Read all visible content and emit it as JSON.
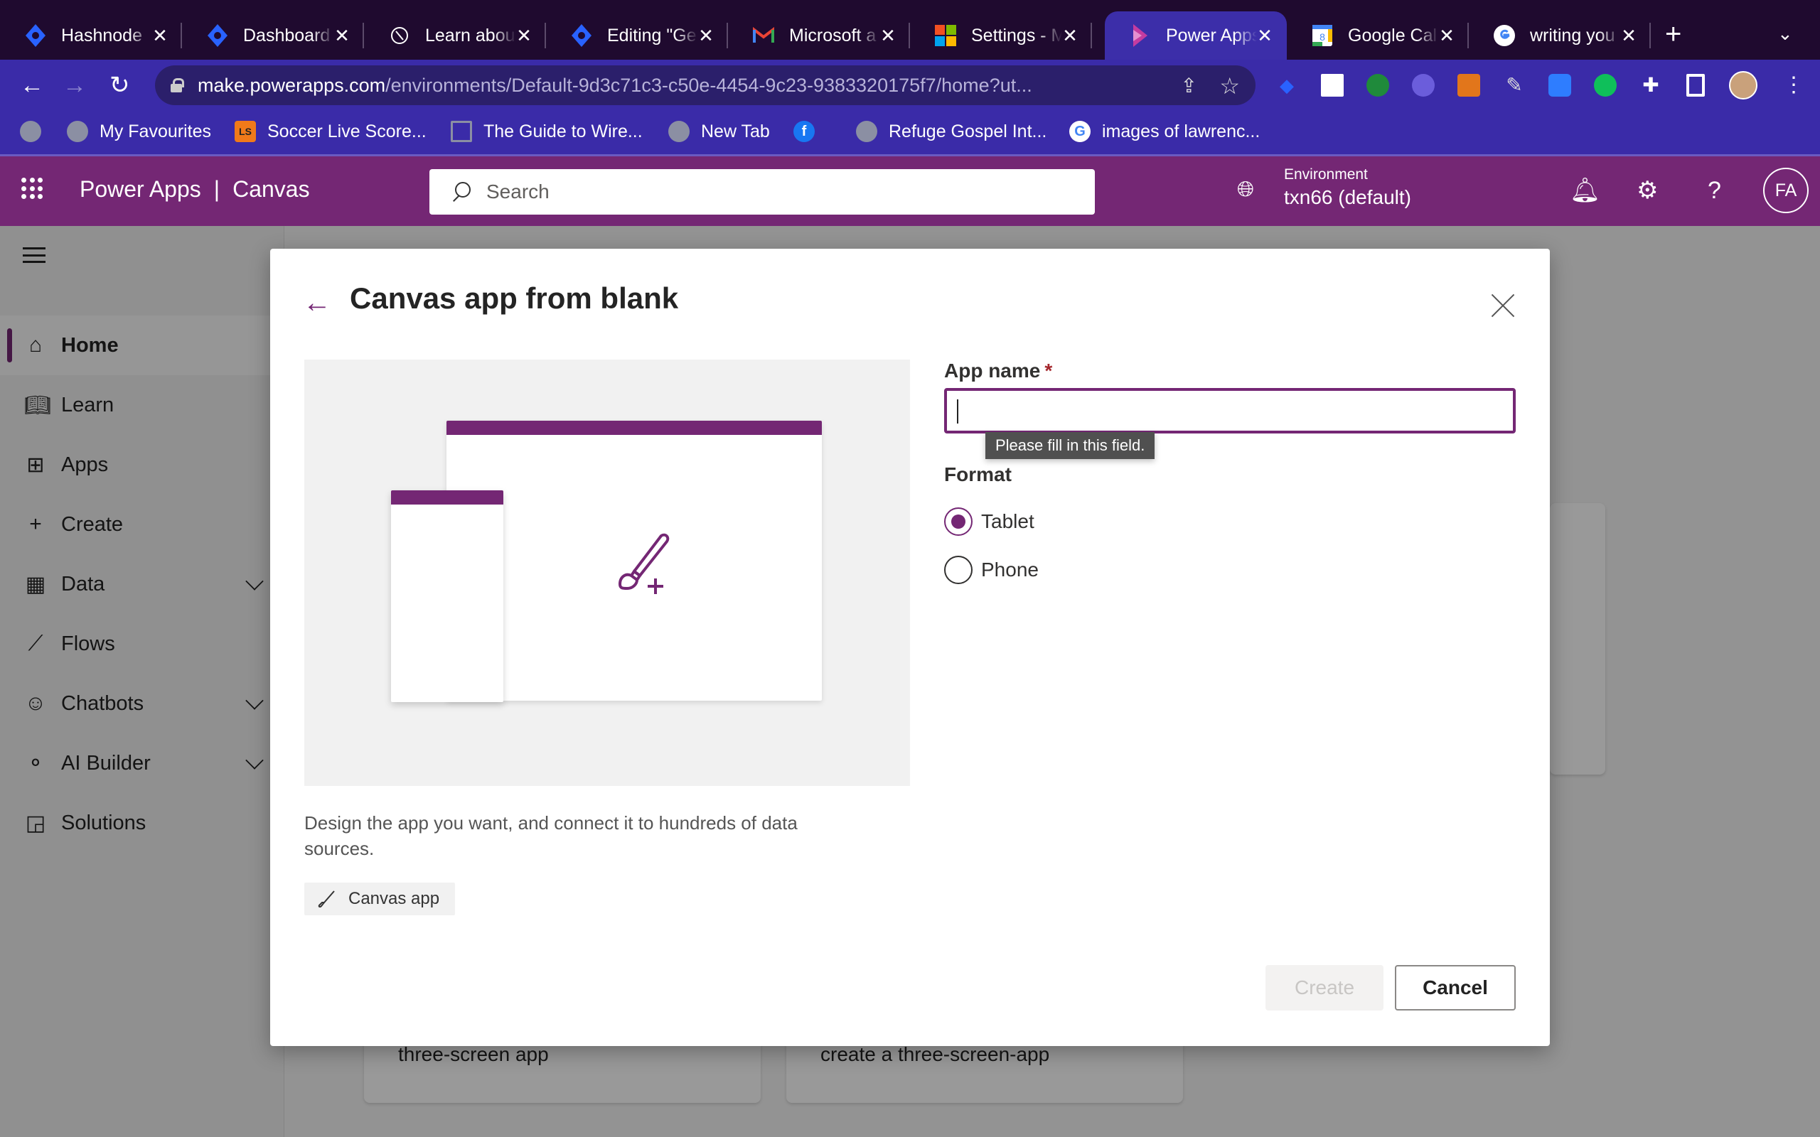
{
  "browser": {
    "tabs": [
      {
        "title": "Hashnode",
        "icon": "hashnode-icon",
        "color": "#2962ff"
      },
      {
        "title": "Dashboard",
        "icon": "hashnode-icon",
        "color": "#2962ff"
      },
      {
        "title": "Learn about",
        "icon": "notion-icon",
        "color": "#ffffff"
      },
      {
        "title": "Editing \"Ge",
        "icon": "hashnode-icon",
        "color": "#2962ff"
      },
      {
        "title": "Microsoft a",
        "icon": "gmail-icon",
        "color": "#ea4335"
      },
      {
        "title": "Settings - M",
        "icon": "microsoft-icon",
        "color": "#f25022"
      },
      {
        "title": "Power Apps",
        "icon": "powerapps-icon",
        "color": "#c43ca0",
        "active": true
      },
      {
        "title": "Google Cal",
        "icon": "google-calendar-icon",
        "color": "#4285f4"
      },
      {
        "title": "writing you",
        "icon": "google-icon",
        "color": "#ffffff"
      }
    ],
    "close_glyph": "✕",
    "new_tab_glyph": "+",
    "tab_menu_glyph": "⌄",
    "url_host": "make.powerapps.com",
    "url_path": "/environments/Default-9d3c71c3-c50e-4454-9c23-9383320175f7/home?ut...",
    "bookmarks": [
      {
        "label": "",
        "icon": "globe-icon"
      },
      {
        "label": "My Favourites",
        "icon": "globe-icon"
      },
      {
        "label": "Soccer Live Score...",
        "icon": "livescore-icon"
      },
      {
        "label": "The Guide to Wire...",
        "icon": "page-icon"
      },
      {
        "label": "New Tab",
        "icon": "globe-icon"
      },
      {
        "label": "",
        "icon": "facebook-icon"
      },
      {
        "label": "Refuge Gospel Int...",
        "icon": "globe-icon"
      },
      {
        "label": "images of lawrenc...",
        "icon": "google-icon"
      }
    ]
  },
  "app": {
    "product": "Power Apps",
    "separator": "|",
    "context": "Canvas",
    "search_placeholder": "Search",
    "environment_label": "Environment",
    "environment_value": "txn66 (default)",
    "user_initials": "FA",
    "brand_color": "#742774"
  },
  "nav": {
    "items": [
      {
        "label": "Home",
        "icon": "home-icon",
        "active": true
      },
      {
        "label": "Learn",
        "icon": "book-icon"
      },
      {
        "label": "Apps",
        "icon": "apps-icon"
      },
      {
        "label": "Create",
        "icon": "plus-icon"
      },
      {
        "label": "Data",
        "icon": "table-icon",
        "expandable": true
      },
      {
        "label": "Flows",
        "icon": "flow-icon"
      },
      {
        "label": "Chatbots",
        "icon": "bot-icon",
        "expandable": true
      },
      {
        "label": "AI Builder",
        "icon": "ai-builder-icon",
        "expandable": true
      },
      {
        "label": "Solutions",
        "icon": "solutions-icon"
      }
    ]
  },
  "background": {
    "cards": [
      "three-screen app",
      "create a three-screen-app"
    ]
  },
  "dialog": {
    "title": "Canvas app from blank",
    "description": "Design the app you want, and connect it to hundreds of data sources.",
    "tag": "Canvas app",
    "app_name_label": "App name",
    "required_mark": "*",
    "app_name_value": "",
    "validation_tooltip": "Please fill in this field.",
    "format_label": "Format",
    "format_options": [
      {
        "label": "Tablet",
        "checked": true
      },
      {
        "label": "Phone",
        "checked": false
      }
    ],
    "create_label": "Create",
    "cancel_label": "Cancel"
  }
}
